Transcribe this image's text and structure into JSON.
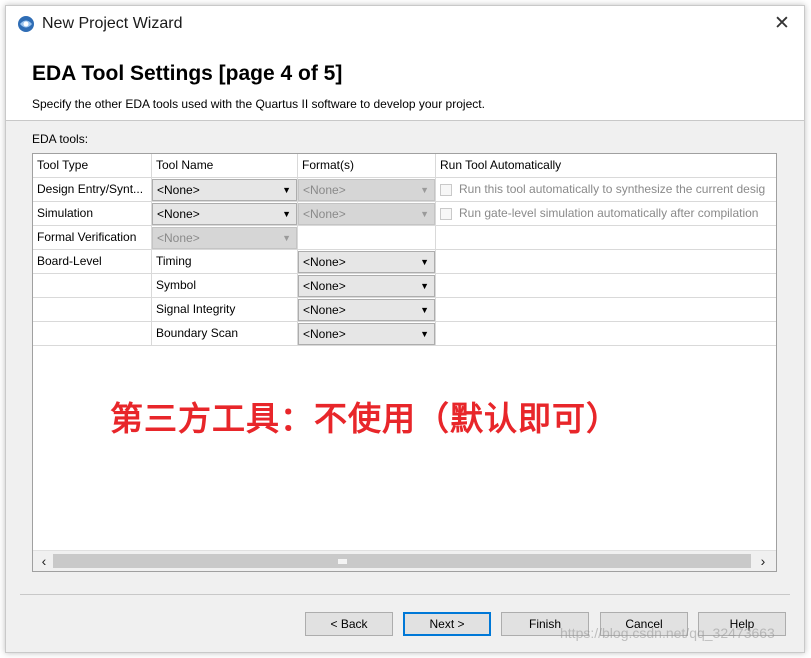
{
  "window": {
    "title": "New Project Wizard",
    "close_glyph": "✕",
    "icon": "quartus-app-icon"
  },
  "header": {
    "title": "EDA Tool Settings [page 4 of 5]",
    "description": "Specify the other EDA tools used with the Quartus II software to develop your project."
  },
  "section_label": "EDA tools:",
  "table": {
    "columns": [
      "Tool Type",
      "Tool Name",
      "Format(s)",
      "Run Tool Automatically"
    ],
    "rows": [
      {
        "type": "Design Entry/Synt...",
        "name": "<None>",
        "name_disabled": false,
        "format": "<None>",
        "format_disabled": true,
        "run": "Run this tool automatically to synthesize the current desig",
        "has_checkbox": true
      },
      {
        "type": "Simulation",
        "name": "<None>",
        "name_disabled": false,
        "format": "<None>",
        "format_disabled": true,
        "run": "Run gate-level simulation automatically after compilation",
        "has_checkbox": true
      },
      {
        "type": "Formal Verification",
        "name": "<None>",
        "name_disabled": true,
        "format": "",
        "format_disabled": false,
        "run": "",
        "has_checkbox": false
      },
      {
        "type": "Board-Level",
        "name": "Timing",
        "name_is_text": true,
        "format": "<None>",
        "format_disabled": false,
        "run": "",
        "has_checkbox": false
      },
      {
        "type": "",
        "name": "Symbol",
        "name_is_text": true,
        "format": "<None>",
        "format_disabled": false,
        "run": "",
        "has_checkbox": false
      },
      {
        "type": "",
        "name": "Signal Integrity",
        "name_is_text": true,
        "format": "<None>",
        "format_disabled": false,
        "run": "",
        "has_checkbox": false
      },
      {
        "type": "",
        "name": "Boundary Scan",
        "name_is_text": true,
        "format": "<None>",
        "format_disabled": false,
        "run": "",
        "has_checkbox": false
      }
    ]
  },
  "annotation": "第三方工具：不使用（默认即可）",
  "scrollbar": {
    "left_glyph": "‹",
    "right_glyph": "›"
  },
  "buttons": {
    "back": "< Back",
    "next": "Next >",
    "finish": "Finish",
    "cancel": "Cancel",
    "help": "Help"
  },
  "watermark": "https://blog.csdn.net/qq_32473663",
  "colors": {
    "annotation": "#e8262a",
    "default_button_border": "#0078d7"
  }
}
